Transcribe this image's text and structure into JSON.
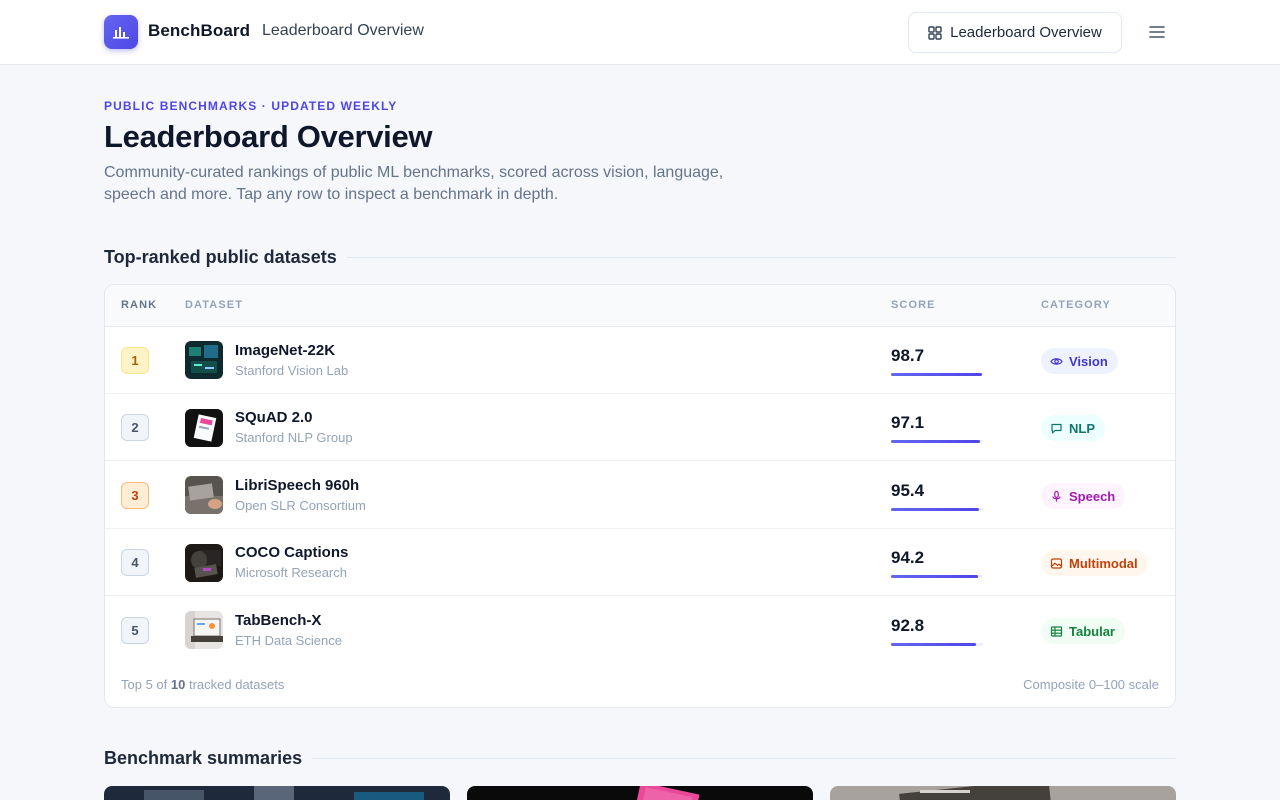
{
  "header": {
    "brand": "BenchBoard",
    "breadcrumb": "Leaderboard Overview",
    "nav_button_label": "Leaderboard Overview",
    "brand_color": "#4f46e5"
  },
  "hero": {
    "eyebrow": "PUBLIC BENCHMARKS · UPDATED WEEKLY",
    "title": "Leaderboard Overview",
    "subtitle": "Community-curated rankings of public ML benchmarks, scored across vision, language, speech and more. Tap any row to inspect a benchmark in depth."
  },
  "leaderboard": {
    "section_title": "Top-ranked public datasets",
    "columns": [
      "RANK",
      "DATASET",
      "SCORE",
      "CATEGORY"
    ],
    "rows": [
      {
        "rank": "1",
        "name": "ImageNet-22K",
        "org": "Stanford Vision Lab",
        "score": "98.7",
        "category": "Vision",
        "icon": "eye-icon"
      },
      {
        "rank": "2",
        "name": "SQuAD 2.0",
        "org": "Stanford NLP Group",
        "score": "97.1",
        "category": "NLP",
        "icon": "chat-icon"
      },
      {
        "rank": "3",
        "name": "LibriSpeech 960h",
        "org": "Open SLR Consortium",
        "score": "95.4",
        "category": "Speech",
        "icon": "microphone-icon"
      },
      {
        "rank": "4",
        "name": "COCO Captions",
        "org": "Microsoft Research",
        "score": "94.2",
        "category": "Multimodal",
        "icon": "image-icon"
      },
      {
        "rank": "5",
        "name": "TabBench-X",
        "org": "ETH Data Science",
        "score": "92.8",
        "category": "Tabular",
        "icon": "table-icon"
      }
    ],
    "footer_prefix": "Top 5 of",
    "footer_count": "10",
    "footer_suffix": "tracked datasets",
    "scale_note": "Composite 0–100 scale"
  },
  "summaries": {
    "section_title": "Benchmark summaries"
  }
}
